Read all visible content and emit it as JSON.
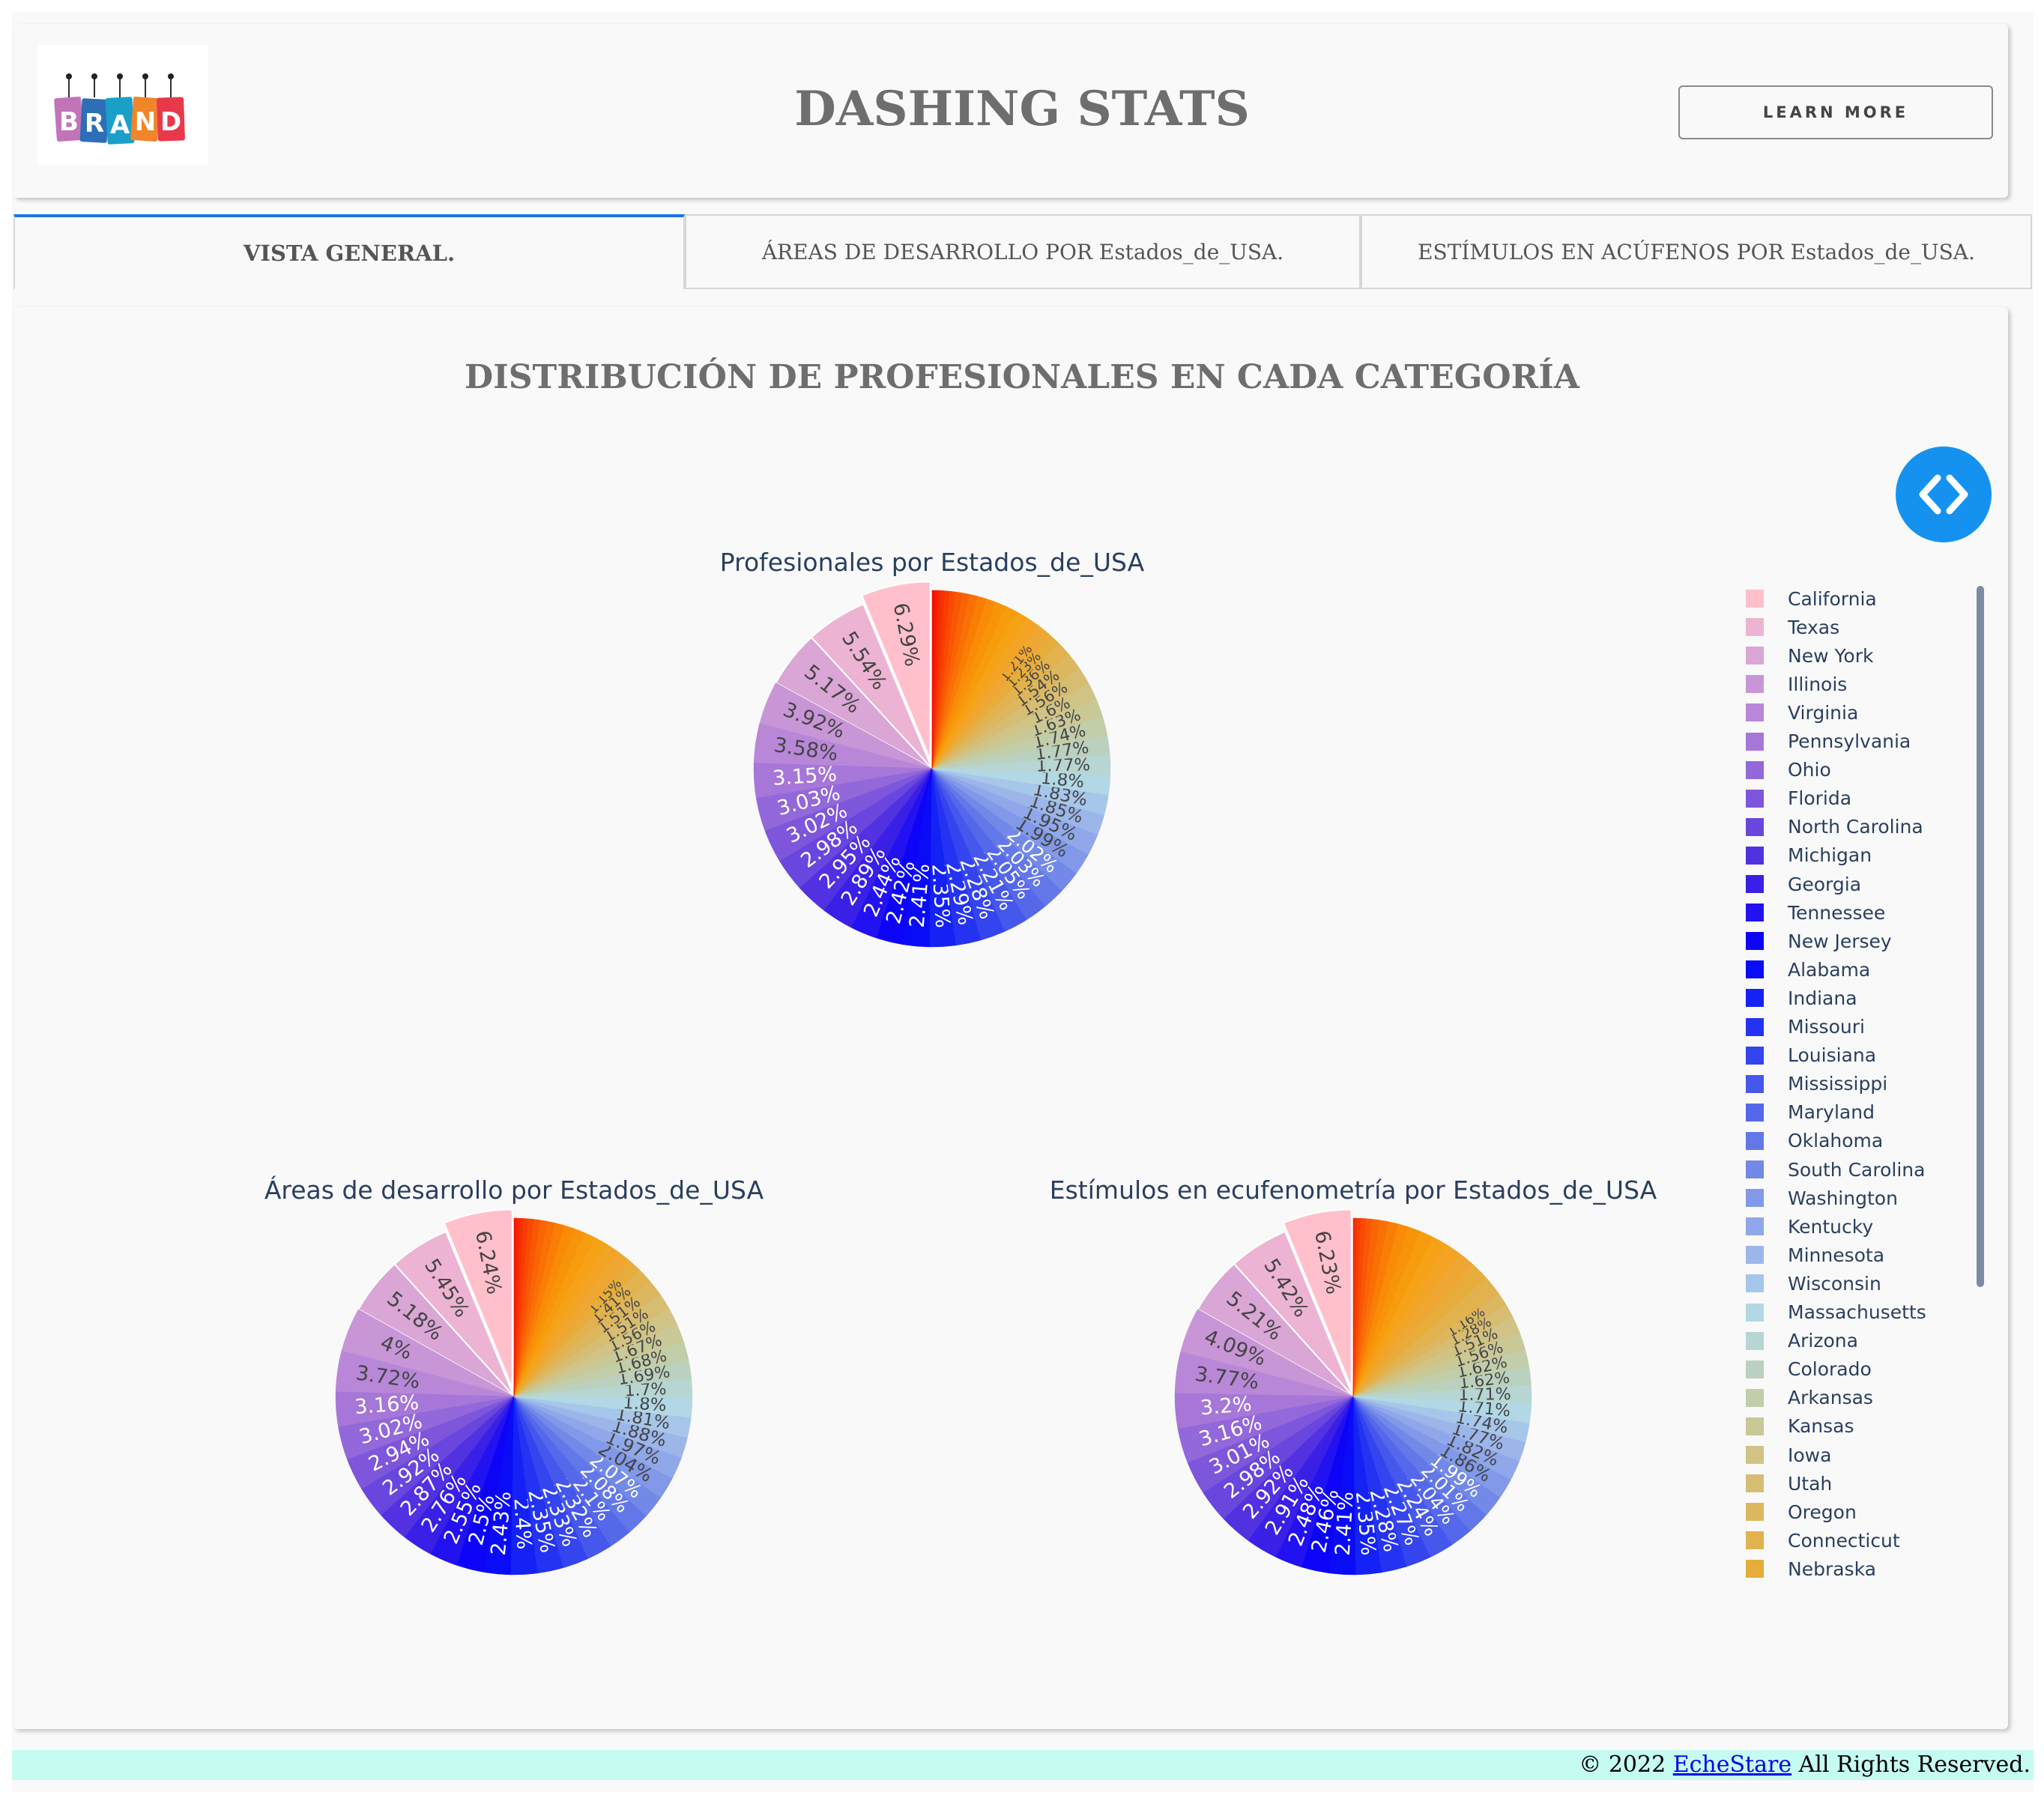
{
  "header": {
    "logo_text": "BRAND",
    "title": "DASHING STATS",
    "learn_more_label": "LEARN MORE"
  },
  "tabs": [
    {
      "label": "VISTA GENERAL.",
      "active": true
    },
    {
      "label": "ÁREAS DE DESARROLLO POR Estados_de_USA.",
      "active": false
    },
    {
      "label": "ESTÍMULOS EN ACÚFENOS POR Estados_de_USA.",
      "active": false
    }
  ],
  "main": {
    "title": "DISTRIBUCIÓN DE PROFESIONALES EN CADA CATEGORÍA"
  },
  "footer": {
    "prefix": "© 2022 ",
    "link_text": "EcheStare",
    "suffix": " All Rights Reserved."
  },
  "colors": {
    "accent": "#1b74e4",
    "toggle_button": "#1592ef",
    "footer_bg": "#c5fbf1",
    "title_gray": "#6e6e6e"
  },
  "icons": {
    "code_toggle": "code-brackets-icon"
  },
  "chart_data": [
    {
      "type": "pie",
      "title": "Profesionales por Estados_de_USA",
      "pulled_slice": "California",
      "labeled_percents": [
        6.29,
        5.54,
        5.17,
        3.92,
        3.58,
        3.15,
        3.03,
        3.02,
        2.98,
        2.95,
        2.89,
        2.44,
        2.42,
        2.41,
        2.35,
        2.29,
        2.28,
        2.21,
        2.05,
        2.03,
        2.02,
        1.99,
        1.95,
        1.85,
        1.83,
        1.8,
        1.77,
        1.77,
        1.74,
        1.63,
        1.6,
        1.56,
        1.54,
        1.36,
        1.23,
        1.21
      ]
    },
    {
      "type": "pie",
      "title": "Áreas de desarrollo por Estados_de_USA",
      "pulled_slice": "California",
      "labeled_percents": [
        6.24,
        5.45,
        5.18,
        4,
        3.72,
        3.16,
        3.02,
        2.94,
        2.92,
        2.87,
        2.76,
        2.55,
        2.5,
        2.43,
        2.4,
        2.35,
        2.33,
        2.32,
        2.1,
        2.08,
        2.07,
        2.04,
        1.97,
        1.88,
        1.81,
        1.8,
        1.7,
        1.69,
        1.68,
        1.67,
        1.56,
        1.51,
        1.51,
        1.41,
        1.15
      ]
    },
    {
      "type": "pie",
      "title": "Estímulos en ecufenometría por Estados_de_USA",
      "pulled_slice": "California",
      "labeled_percents": [
        6.23,
        5.42,
        5.21,
        4.09,
        3.77,
        3.2,
        3.16,
        3.01,
        2.98,
        2.92,
        2.91,
        2.48,
        2.46,
        2.41,
        2.35,
        2.28,
        2.27,
        2.24,
        2.04,
        2.01,
        1.99,
        1.86,
        1.82,
        1.77,
        1.74,
        1.71,
        1.71,
        1.62,
        1.62,
        1.56,
        1.51,
        1.28,
        1.16
      ]
    }
  ],
  "legend": [
    {
      "label": "California",
      "color": "#ffc0cb"
    },
    {
      "label": "Texas",
      "color": "#ecb4d2"
    },
    {
      "label": "New York",
      "color": "#d9a6d6"
    },
    {
      "label": "Illinois",
      "color": "#c896d7"
    },
    {
      "label": "Virginia",
      "color": "#b887d8"
    },
    {
      "label": "Pennsylvania",
      "color": "#a677d9"
    },
    {
      "label": "Ohio",
      "color": "#9268da"
    },
    {
      "label": "Florida",
      "color": "#7d56dc"
    },
    {
      "label": "North Carolina",
      "color": "#6946dd"
    },
    {
      "label": "Michigan",
      "color": "#5231e1"
    },
    {
      "label": "Georgia",
      "color": "#3a1fe7"
    },
    {
      "label": "Tennessee",
      "color": "#2211f0"
    },
    {
      "label": "New Jersey",
      "color": "#0d04f7"
    },
    {
      "label": "Alabama",
      "color": "#0a0cf8"
    },
    {
      "label": "Indiana",
      "color": "#1422f5"
    },
    {
      "label": "Missouri",
      "color": "#2433f2"
    },
    {
      "label": "Louisiana",
      "color": "#3444ef"
    },
    {
      "label": "Mississippi",
      "color": "#4657ec"
    },
    {
      "label": "Maryland",
      "color": "#5568ea"
    },
    {
      "label": "Oklahoma",
      "color": "#6378e8"
    },
    {
      "label": "South Carolina",
      "color": "#7389e8"
    },
    {
      "label": "Washington",
      "color": "#8199e8"
    },
    {
      "label": "Kentucky",
      "color": "#90a8e9"
    },
    {
      "label": "Minnesota",
      "color": "#9cb6ea"
    },
    {
      "label": "Wisconsin",
      "color": "#a6c6ea"
    },
    {
      "label": "Massachusetts",
      "color": "#b1d8e4"
    },
    {
      "label": "Arizona",
      "color": "#b7d6d3"
    },
    {
      "label": "Colorado",
      "color": "#bbd1bf"
    },
    {
      "label": "Arkansas",
      "color": "#c2cdaa"
    },
    {
      "label": "Kansas",
      "color": "#c9c897"
    },
    {
      "label": "Iowa",
      "color": "#d0c385"
    },
    {
      "label": "Utah",
      "color": "#d6bd72"
    },
    {
      "label": "Oregon",
      "color": "#dcb760"
    },
    {
      "label": "Connecticut",
      "color": "#e1b24d"
    },
    {
      "label": "Nebraska",
      "color": "#e6ad3a"
    }
  ]
}
